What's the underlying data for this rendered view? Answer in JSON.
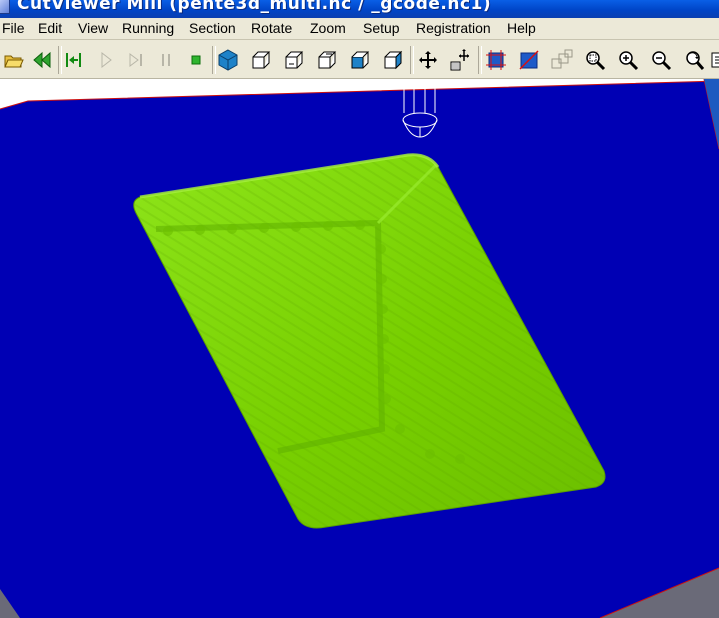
{
  "window": {
    "title": "CutViewer Mill (pente3d_multi.nc / _gcode.nc1)"
  },
  "menu": {
    "items": [
      {
        "label": "File"
      },
      {
        "label": "Edit"
      },
      {
        "label": "View"
      },
      {
        "label": "Running"
      },
      {
        "label": "Section"
      },
      {
        "label": "Rotate"
      },
      {
        "label": "Zoom"
      },
      {
        "label": "Setup"
      },
      {
        "label": "Registration"
      },
      {
        "label": "Help"
      }
    ]
  },
  "toolbar": {
    "buttons": [
      {
        "icon": "open-folder-icon"
      },
      {
        "icon": "rewind-icon"
      },
      {
        "icon": "step-to-start-icon"
      },
      {
        "icon": "play-icon"
      },
      {
        "icon": "step-forward-icon"
      },
      {
        "icon": "pause-icon"
      },
      {
        "icon": "stop-icon"
      },
      {
        "icon": "solid-cube-icon"
      },
      {
        "icon": "cube-view-1-icon"
      },
      {
        "icon": "cube-view-2-icon"
      },
      {
        "icon": "cube-view-3-icon"
      },
      {
        "icon": "cube-view-4-icon"
      },
      {
        "icon": "cube-view-5-icon"
      },
      {
        "icon": "pan-icon"
      },
      {
        "icon": "move-hand-icon"
      },
      {
        "icon": "section-box-icon"
      },
      {
        "icon": "section-plane-icon"
      },
      {
        "icon": "outline-windows-icon"
      },
      {
        "icon": "zoom-window-icon"
      },
      {
        "icon": "zoom-in-icon"
      },
      {
        "icon": "zoom-out-icon"
      },
      {
        "icon": "rotate-view-icon"
      },
      {
        "icon": "fit-view-icon"
      }
    ]
  },
  "viewport": {
    "background_color": "#ffffff",
    "stock_top_color": "#0000b4",
    "stock_edge_color": "#cc1010",
    "machined_surface_color": "#7fd000",
    "tool_color": "#ffffff"
  }
}
